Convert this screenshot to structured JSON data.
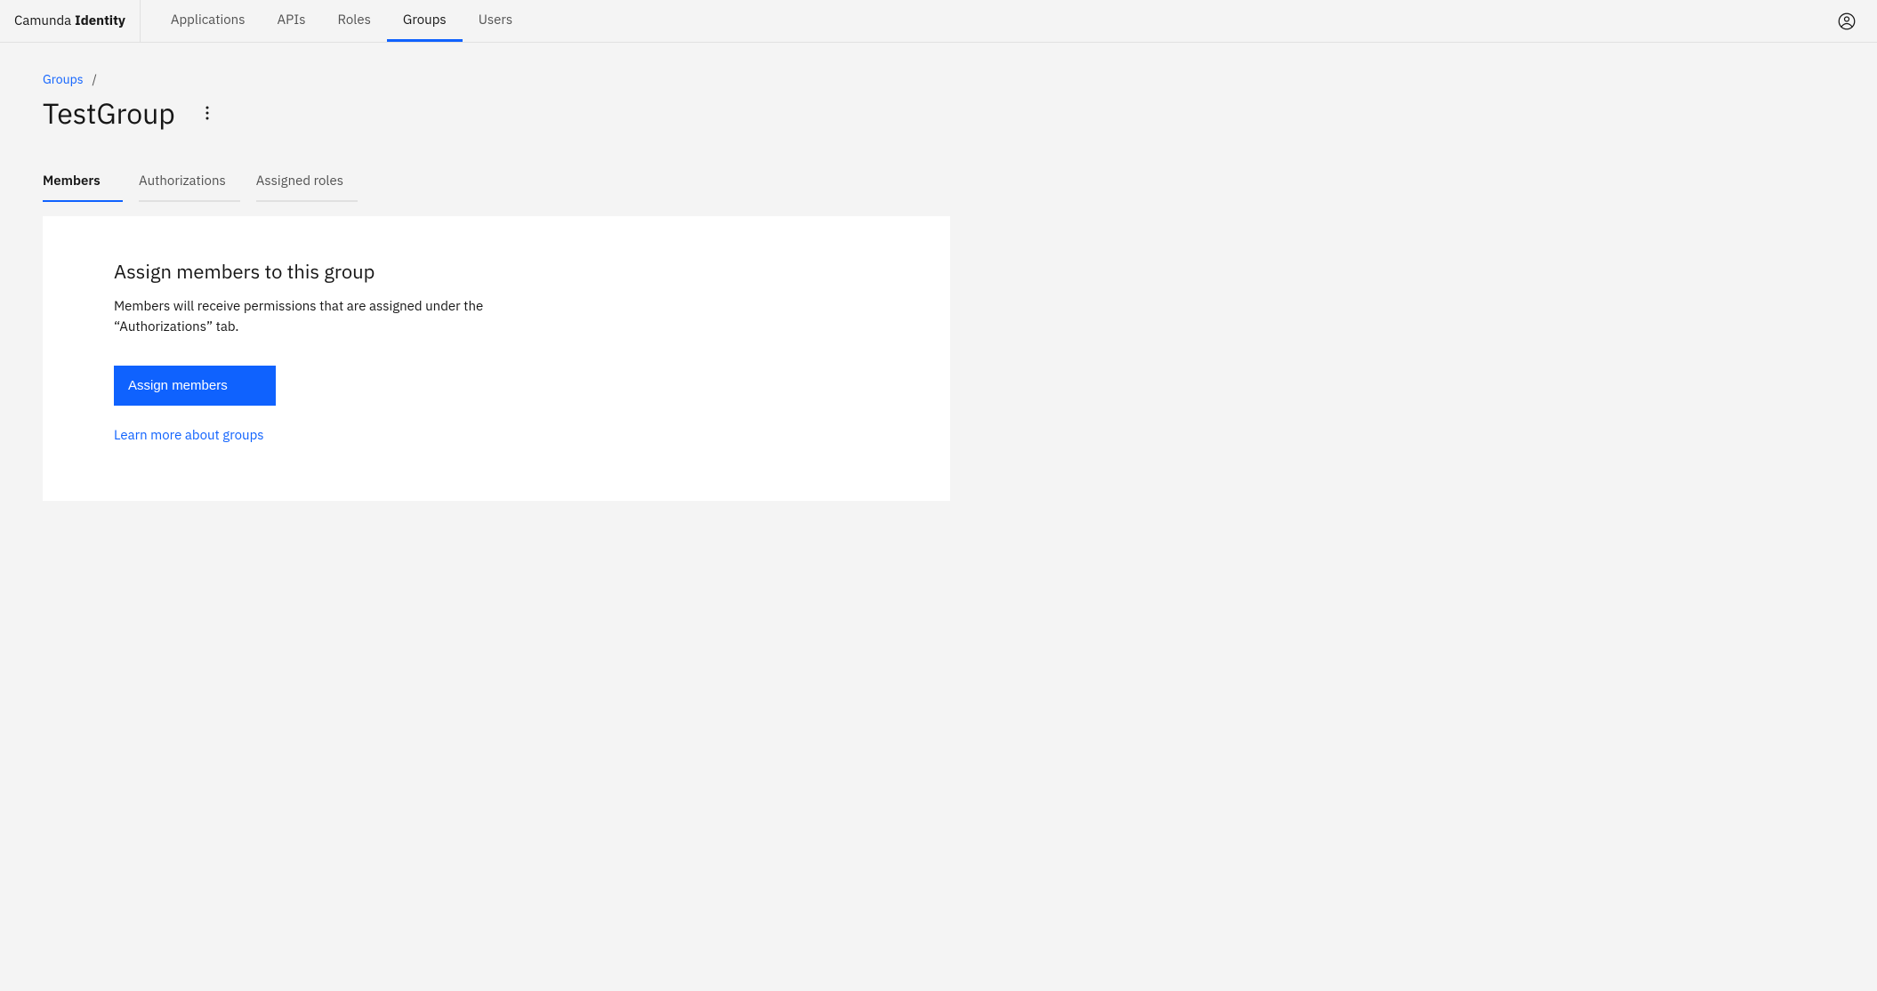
{
  "header": {
    "brand_prefix": "Camunda",
    "brand_strong": "Identity",
    "nav": [
      {
        "label": "Applications",
        "active": false
      },
      {
        "label": "APIs",
        "active": false
      },
      {
        "label": "Roles",
        "active": false
      },
      {
        "label": "Groups",
        "active": true
      },
      {
        "label": "Users",
        "active": false
      }
    ]
  },
  "breadcrumb": {
    "parent": "Groups",
    "separator": "/"
  },
  "page": {
    "title": "TestGroup"
  },
  "tabs": [
    {
      "label": "Members",
      "active": true
    },
    {
      "label": "Authorizations",
      "active": false
    },
    {
      "label": "Assigned roles",
      "active": false
    }
  ],
  "empty_state": {
    "heading": "Assign members to this group",
    "description": "Members will receive permissions that are assigned under the “Authorizations” tab.",
    "primary_button": "Assign members",
    "learn_more": "Learn more about groups"
  }
}
